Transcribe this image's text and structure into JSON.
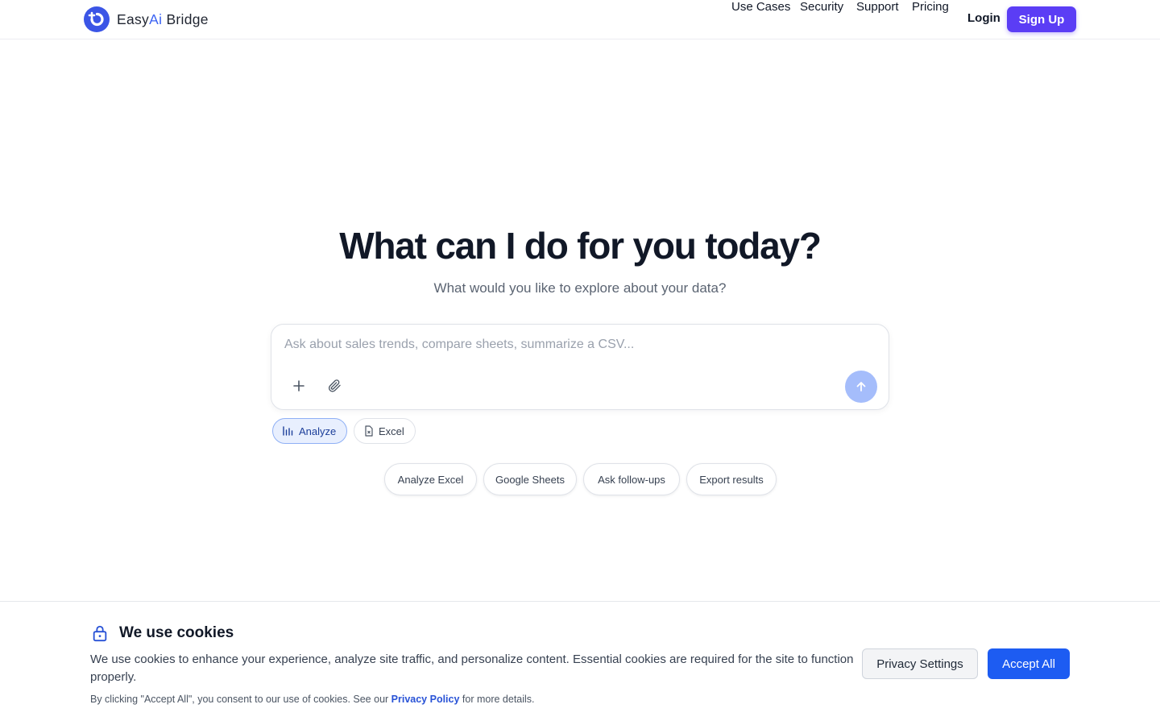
{
  "brand": {
    "name_prefix": "Easy",
    "name_ai": "Ai",
    "name_suffix": " Bridge",
    "accent": "#5b3df5",
    "logo_color": "#3b63f3",
    "logo_icon": "bridge-logo-icon"
  },
  "nav": {
    "links": [
      "Use Cases",
      "Security",
      "Support",
      "Pricing"
    ],
    "login": "Login",
    "signup": "Sign Up"
  },
  "hero": {
    "title": "What can I do for you today?",
    "subtitle": "What would you like to explore about your data?"
  },
  "prompt": {
    "placeholder": "Ask about sales trends, compare sheets, summarize a CSV...",
    "value": "",
    "add_icon": "plus-icon",
    "attach_icon": "paperclip-icon",
    "send_icon": "arrow-up-icon"
  },
  "modes": [
    {
      "label": "Analyze",
      "icon": "bar-chart-icon",
      "active": true
    },
    {
      "label": "Excel",
      "icon": "file-icon",
      "active": false
    }
  ],
  "suggestions": [
    "Analyze Excel",
    "Google Sheets",
    "Ask follow-ups",
    "Export results"
  ],
  "cookie": {
    "title": "We use cookies",
    "body": "We use cookies to enhance your experience, analyze site traffic, and personalize content. Essential cookies are required for the site to function properly.",
    "note_before": "By clicking \"Accept All\", you consent to our use of cookies. See our ",
    "note_link": "Privacy Policy",
    "note_after": " for more details.",
    "privacy_button": "Privacy Settings",
    "accept_button": "Accept All",
    "lock_icon": "lock-icon"
  }
}
